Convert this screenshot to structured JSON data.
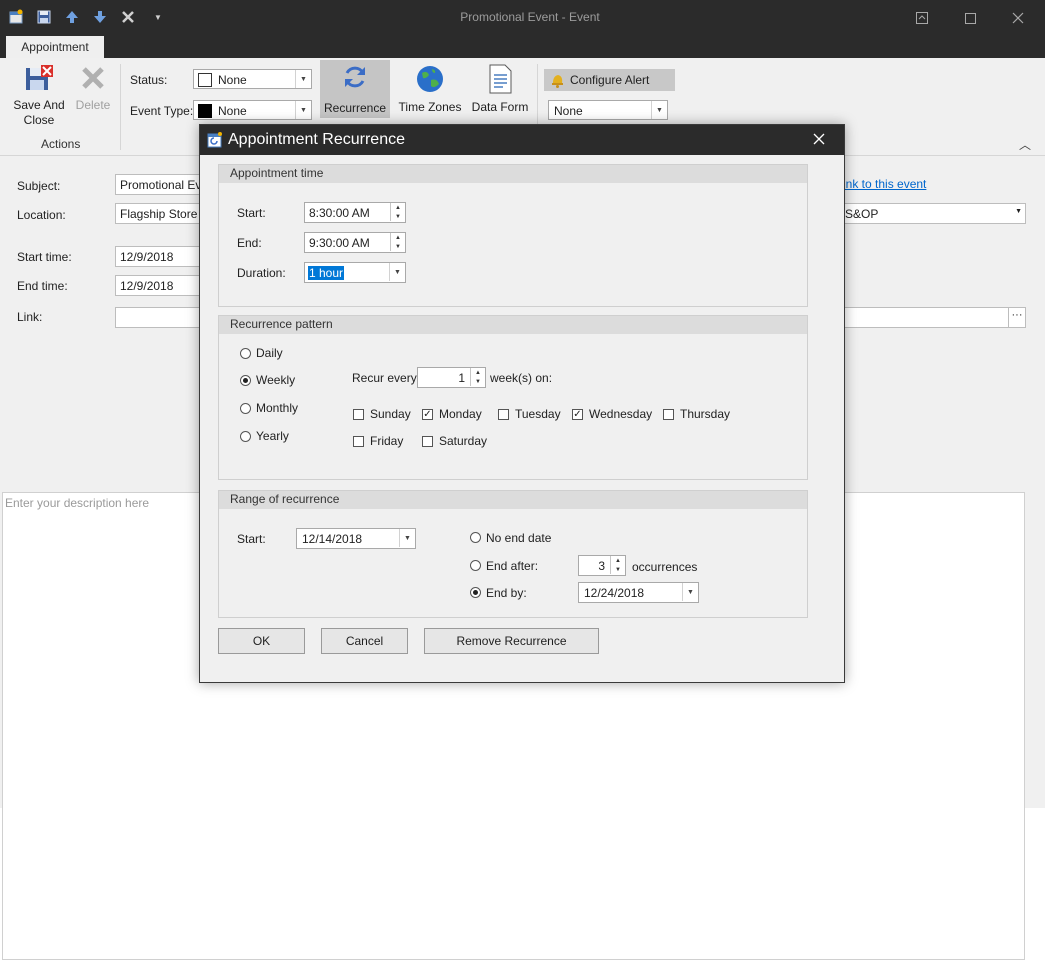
{
  "window": {
    "title": "Promotional Event - Event"
  },
  "tabs": [
    "Appointment"
  ],
  "ribbon": {
    "save_close": "Save And Close",
    "delete": "Delete",
    "actions_group": "Actions",
    "status_label": "Status:",
    "status_value": "None",
    "event_type_label": "Event Type:",
    "event_type_value": "None",
    "recurrence": "Recurrence",
    "time_zones": "Time Zones",
    "data_form": "Data Form",
    "configure_alert": "Configure Alert",
    "alert_value": "None"
  },
  "form": {
    "subject_label": "Subject:",
    "subject_value": "Promotional Ev",
    "location_label": "Location:",
    "location_value": "Flagship Store",
    "start_label": "Start time:",
    "start_value": "12/9/2018",
    "end_label": "End time:",
    "end_value": "12/9/2018",
    "link_label": "Link:",
    "link_to_event": "ink to this event",
    "category_value": "S&OP",
    "description_placeholder": "Enter your description here"
  },
  "dialog": {
    "title": "Appointment Recurrence",
    "appointment_time": {
      "header": "Appointment time",
      "start_label": "Start:",
      "start_value": "8:30:00 AM",
      "end_label": "End:",
      "end_value": "9:30:00 AM",
      "duration_label": "Duration:",
      "duration_value": "1 hour"
    },
    "pattern": {
      "header": "Recurrence pattern",
      "options": [
        "Daily",
        "Weekly",
        "Monthly",
        "Yearly"
      ],
      "selected": "Weekly",
      "recur_every_label": "Recur every",
      "recur_every_value": "1",
      "weeks_on_label": "week(s) on:",
      "days": [
        {
          "name": "Sunday",
          "checked": false
        },
        {
          "name": "Monday",
          "checked": true
        },
        {
          "name": "Tuesday",
          "checked": false
        },
        {
          "name": "Wednesday",
          "checked": true
        },
        {
          "name": "Thursday",
          "checked": false
        },
        {
          "name": "Friday",
          "checked": false
        },
        {
          "name": "Saturday",
          "checked": false
        }
      ]
    },
    "range": {
      "header": "Range of recurrence",
      "start_label": "Start:",
      "start_value": "12/14/2018",
      "no_end_label": "No end date",
      "end_after_label": "End after:",
      "end_after_value": "3",
      "occurrences_label": "occurrences",
      "end_by_label": "End by:",
      "end_by_value": "12/24/2018",
      "selected": "End by"
    },
    "buttons": {
      "ok": "OK",
      "cancel": "Cancel",
      "remove": "Remove Recurrence"
    }
  },
  "colors": {
    "titlebar": "#2b2b2b",
    "link": "#0066cc",
    "selection": "#0078d7"
  }
}
